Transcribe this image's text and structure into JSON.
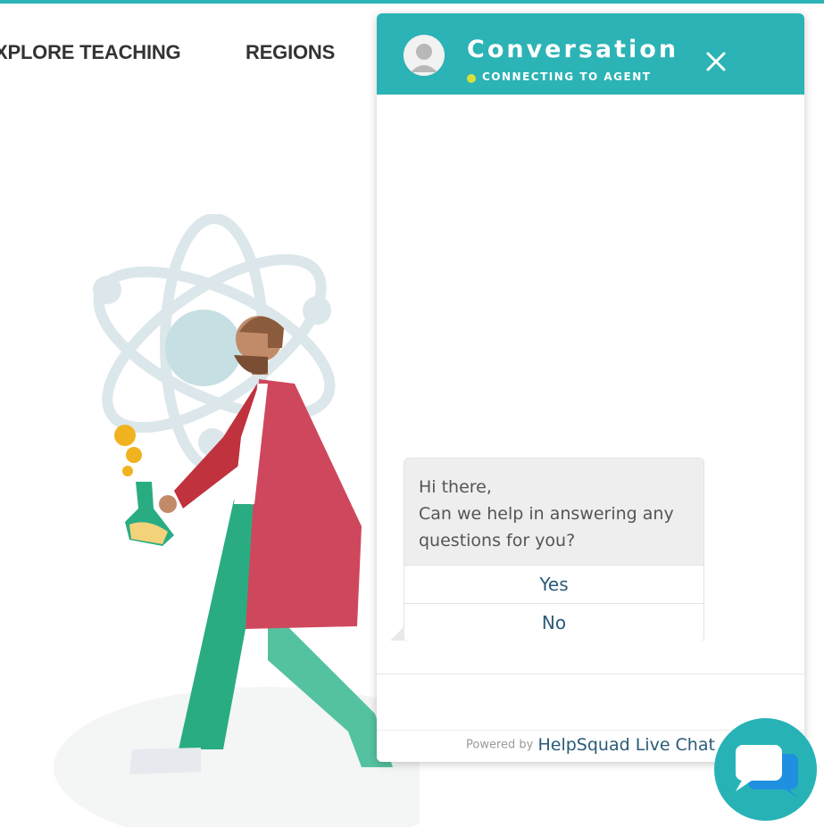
{
  "nav": {
    "items": [
      {
        "label": "XPLORE TEACHING"
      },
      {
        "label": "REGIONS"
      }
    ]
  },
  "chat": {
    "title": "Conversation",
    "status": "CONNECTING TO AGENT",
    "message_lines": [
      "Hi there,",
      "Can we help in answering any",
      "questions for you?"
    ],
    "replies": [
      {
        "label": "Yes"
      },
      {
        "label": "No"
      }
    ],
    "powered_by_prefix": "Powered by",
    "powered_by_link": "HelpSquad Live Chat"
  },
  "colors": {
    "accent": "#2cb3b5",
    "status_dot": "#d7e03a",
    "link": "#2a5a78"
  },
  "icons": {
    "avatar": "user-avatar-icon",
    "close": "close-icon",
    "launcher": "chat-bubbles-icon"
  }
}
